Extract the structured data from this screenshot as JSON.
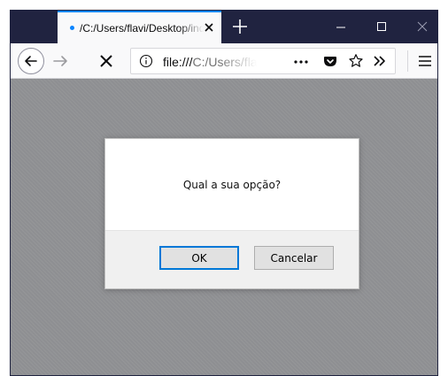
{
  "browser": {
    "tab": {
      "title": "/C:/Users/flavi/Desktop/index.html"
    },
    "url": {
      "scheme": "file:///",
      "host": "C:/Users/flavi/Desktop/index.html"
    }
  },
  "icons": {
    "tab_dot": "loading-dot-icon",
    "tab_close": "close-icon",
    "new_tab": "plus-icon",
    "minimize": "minimize-icon",
    "maximize": "maximize-icon",
    "window_close": "close-icon",
    "back": "arrow-left-icon",
    "forward": "arrow-right-icon",
    "stop": "stop-icon",
    "site_info": "info-icon",
    "page_actions": "ellipsis-icon",
    "pocket": "pocket-icon",
    "bookmark": "star-icon",
    "overflow": "chevron-double-right-icon",
    "menu": "hamburger-icon"
  },
  "dialog": {
    "message": "Qual a sua opção?",
    "ok_label": "OK",
    "cancel_label": "Cancelar"
  },
  "colors": {
    "titlebar": "#202340",
    "tab_accent": "#0a84ff",
    "content_overlay": "#8e8f92",
    "ok_focus": "#0078d7"
  }
}
